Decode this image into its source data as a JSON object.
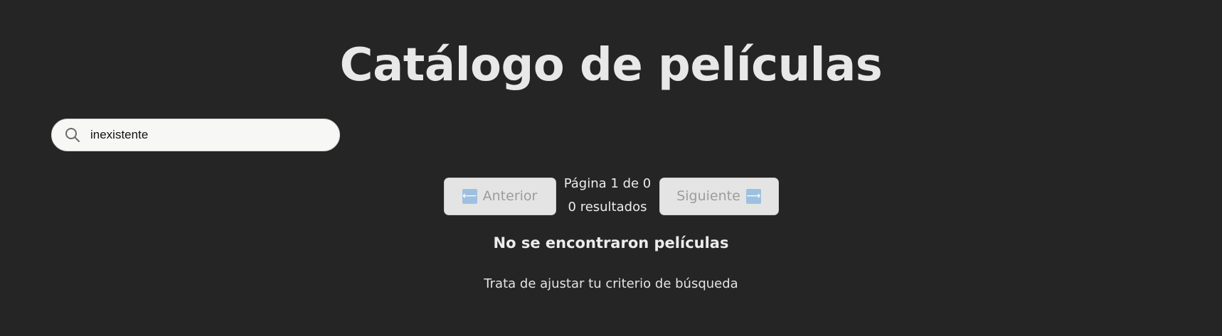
{
  "header": {
    "title": "Catálogo de películas"
  },
  "search": {
    "value": "inexistente",
    "icon": "search-icon"
  },
  "pagination": {
    "prev_label": "Anterior",
    "next_label": "Siguiente",
    "prev_arrow": "⟵",
    "next_arrow": "⟶",
    "page_text": "Página 1 de 0",
    "results_text": "0 resultados"
  },
  "empty_state": {
    "title": "No se encontraron películas",
    "subtitle": "Trata de ajustar tu criterio de búsqueda"
  },
  "colors": {
    "background": "#252525",
    "button_bg": "#e4e4e4",
    "button_text_disabled": "#9c9c9c",
    "arrow_badge": "#9ec0e0"
  }
}
